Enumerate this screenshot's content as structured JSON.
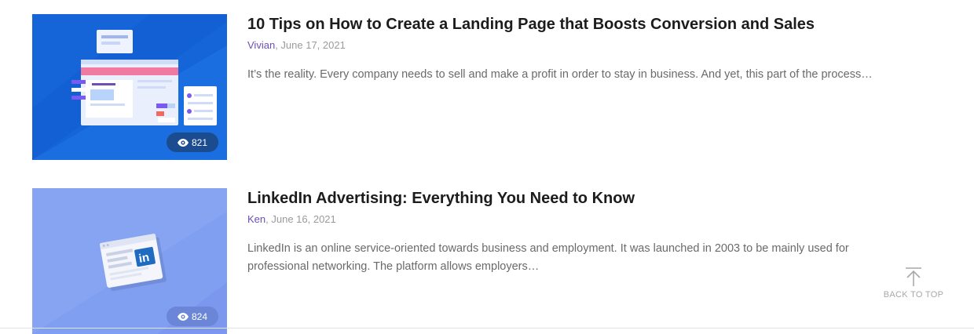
{
  "posts": [
    {
      "title": "10 Tips on How to Create a Landing Page that Boosts Conversion and Sales",
      "author": "Vivian",
      "date": ", June 17, 2021",
      "excerpt": "It’s the reality. Every company needs to sell and make a profit in order to stay in business. And yet, this part of the process…",
      "views": "821",
      "thumb_color": "#1565d8"
    },
    {
      "title": "LinkedIn Advertising: Everything You Need to Know",
      "author": "Ken",
      "date": ", June 16, 2021",
      "excerpt": "LinkedIn is an online service-oriented towards business and employment. It was launched in 2003 to be mainly used for professional networking. The platform allows employers…",
      "views": "824",
      "thumb_color": "#86a4f2"
    }
  ],
  "back_to_top": {
    "label": "BACK TO TOP",
    "icon": "arrow-up-icon"
  },
  "colors": {
    "title": "#1c1c1c",
    "author_link": "#6c4fb6",
    "meta": "#9a9a9a",
    "excerpt": "#6a6a6a"
  }
}
